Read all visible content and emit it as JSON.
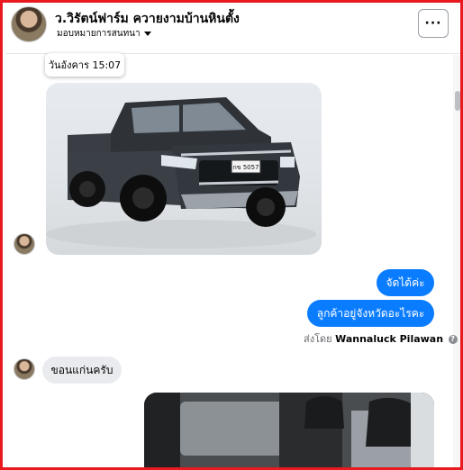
{
  "header": {
    "page_name": "ว.วิรัตน์ฟาร์ม ควายงามบ้านหินตั้ง",
    "assignment": "มอบหมายการสนทนา",
    "more_label": "···"
  },
  "timestamp_tooltip": "วันอังคาร 15:07",
  "car_photo": {
    "plate": "กข 5057"
  },
  "outgoing": [
    {
      "text": "จัดได้ค่ะ"
    },
    {
      "text": "ลูกค้าอยู่จังหวัดอะไรคะ"
    }
  ],
  "sent_by": {
    "prefix": "ส่งโดย",
    "name": "Wannaluck Pilawan",
    "icon": "info-icon"
  },
  "incoming": [
    {
      "text": "ขอนแก่นครับ"
    }
  ],
  "colors": {
    "outgoing_bubble": "#0a7cff",
    "incoming_bubble": "#e9ebee",
    "frame_border": "#e8191f"
  }
}
